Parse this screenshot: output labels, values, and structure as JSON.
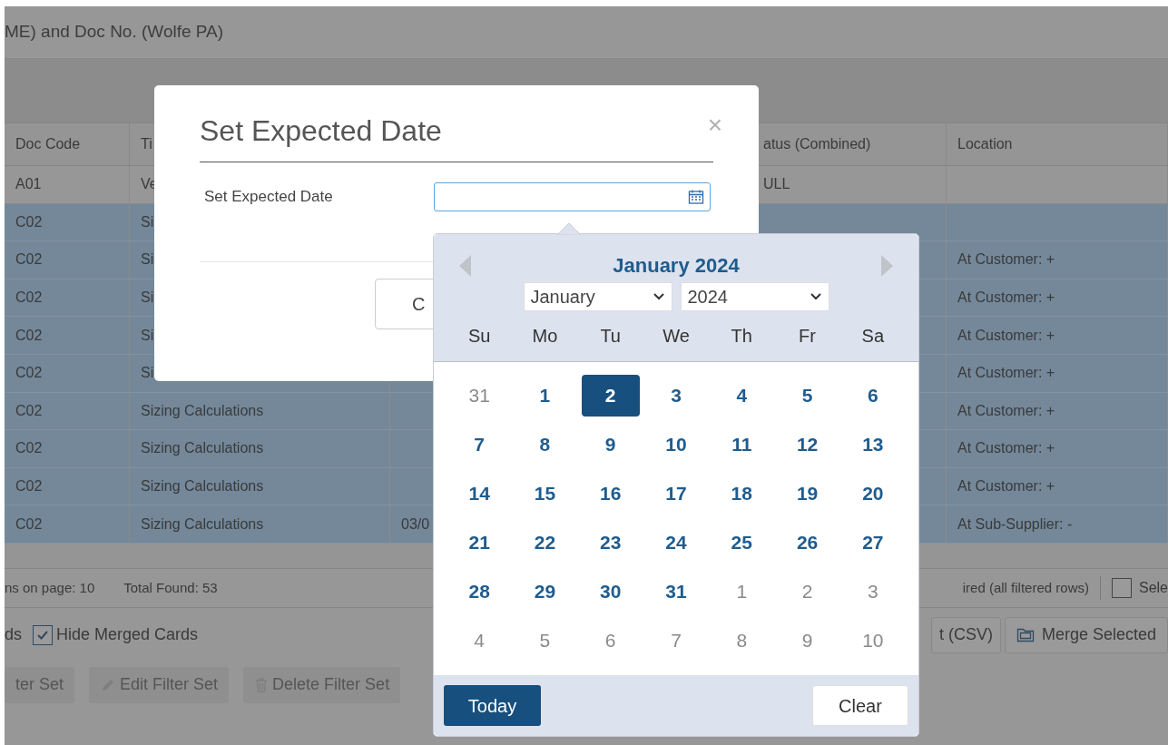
{
  "page_title": "ME) and Doc No. (Wolfe PA)",
  "table": {
    "columns": [
      "Doc Code",
      "Ti",
      "",
      "atus (Combined)",
      "Location"
    ],
    "rows": [
      {
        "selected": false,
        "cells": [
          "A01",
          "Ve",
          "",
          "ULL",
          ""
        ]
      },
      {
        "selected": true,
        "cells": [
          "C02",
          "Si",
          "",
          "",
          ""
        ]
      },
      {
        "selected": true,
        "cells": [
          "C02",
          "Si",
          "",
          "",
          "At Customer: +"
        ]
      },
      {
        "selected": true,
        "cells": [
          "C02",
          "Si",
          "",
          "",
          "At Customer: +"
        ]
      },
      {
        "selected": true,
        "cells": [
          "C02",
          "Si",
          "",
          "",
          "At Customer: +"
        ]
      },
      {
        "selected": true,
        "cells": [
          "C02",
          "Si",
          "",
          "",
          "At Customer: +"
        ]
      },
      {
        "selected": true,
        "cells": [
          "C02",
          "Sizing Calculations",
          "",
          "",
          "At Customer: +"
        ]
      },
      {
        "selected": true,
        "cells": [
          "C02",
          "Sizing Calculations",
          "",
          "",
          "At Customer: +"
        ]
      },
      {
        "selected": true,
        "cells": [
          "C02",
          "Sizing Calculations",
          "",
          "",
          "At Customer: +"
        ]
      },
      {
        "selected": true,
        "cells": [
          "C02",
          "Sizing Calculations",
          "03/0",
          "",
          "At Sub-Supplier: -"
        ]
      }
    ]
  },
  "status_bar": {
    "items_on_page": "ns on page: 10",
    "total": "Total Found: 53",
    "required": "ired (all filtered rows)",
    "select_all": {
      "label": "Sele",
      "checked": false
    }
  },
  "options": {
    "left": "ds",
    "hide_merged": {
      "label": "Hide Merged Cards",
      "checked": true
    },
    "export": "t (CSV)",
    "merge": "Merge Selected"
  },
  "filter_buttons": [
    {
      "kind": "plain",
      "label": "ter Set"
    },
    {
      "kind": "edit",
      "label": "Edit Filter Set"
    },
    {
      "kind": "delete",
      "label": "Delete Filter Set"
    }
  ],
  "modal": {
    "title": "Set Expected Date",
    "close": "×",
    "field_label": "Set Expected Date",
    "footer_button": "C"
  },
  "datepicker": {
    "title": "January 2024",
    "month": "January",
    "year": "2024",
    "weekdays": [
      "Su",
      "Mo",
      "Tu",
      "We",
      "Th",
      "Fr",
      "Sa"
    ],
    "days": [
      {
        "label": "31",
        "in_month": false,
        "selected": false
      },
      {
        "label": "1",
        "in_month": true,
        "selected": false
      },
      {
        "label": "2",
        "in_month": true,
        "selected": true
      },
      {
        "label": "3",
        "in_month": true,
        "selected": false
      },
      {
        "label": "4",
        "in_month": true,
        "selected": false
      },
      {
        "label": "5",
        "in_month": true,
        "selected": false
      },
      {
        "label": "6",
        "in_month": true,
        "selected": false
      },
      {
        "label": "7",
        "in_month": true,
        "selected": false
      },
      {
        "label": "8",
        "in_month": true,
        "selected": false
      },
      {
        "label": "9",
        "in_month": true,
        "selected": false
      },
      {
        "label": "10",
        "in_month": true,
        "selected": false
      },
      {
        "label": "11",
        "in_month": true,
        "selected": false
      },
      {
        "label": "12",
        "in_month": true,
        "selected": false
      },
      {
        "label": "13",
        "in_month": true,
        "selected": false
      },
      {
        "label": "14",
        "in_month": true,
        "selected": false
      },
      {
        "label": "15",
        "in_month": true,
        "selected": false
      },
      {
        "label": "16",
        "in_month": true,
        "selected": false
      },
      {
        "label": "17",
        "in_month": true,
        "selected": false
      },
      {
        "label": "18",
        "in_month": true,
        "selected": false
      },
      {
        "label": "19",
        "in_month": true,
        "selected": false
      },
      {
        "label": "20",
        "in_month": true,
        "selected": false
      },
      {
        "label": "21",
        "in_month": true,
        "selected": false
      },
      {
        "label": "22",
        "in_month": true,
        "selected": false
      },
      {
        "label": "23",
        "in_month": true,
        "selected": false
      },
      {
        "label": "24",
        "in_month": true,
        "selected": false
      },
      {
        "label": "25",
        "in_month": true,
        "selected": false
      },
      {
        "label": "26",
        "in_month": true,
        "selected": false
      },
      {
        "label": "27",
        "in_month": true,
        "selected": false
      },
      {
        "label": "28",
        "in_month": true,
        "selected": false
      },
      {
        "label": "29",
        "in_month": true,
        "selected": false
      },
      {
        "label": "30",
        "in_month": true,
        "selected": false
      },
      {
        "label": "31",
        "in_month": true,
        "selected": false
      },
      {
        "label": "1",
        "in_month": false,
        "selected": false
      },
      {
        "label": "2",
        "in_month": false,
        "selected": false
      },
      {
        "label": "3",
        "in_month": false,
        "selected": false
      },
      {
        "label": "4",
        "in_month": false,
        "selected": false
      },
      {
        "label": "5",
        "in_month": false,
        "selected": false
      },
      {
        "label": "6",
        "in_month": false,
        "selected": false
      },
      {
        "label": "7",
        "in_month": false,
        "selected": false
      },
      {
        "label": "8",
        "in_month": false,
        "selected": false
      },
      {
        "label": "9",
        "in_month": false,
        "selected": false
      },
      {
        "label": "10",
        "in_month": false,
        "selected": false
      }
    ],
    "today": "Today",
    "clear": "Clear"
  }
}
